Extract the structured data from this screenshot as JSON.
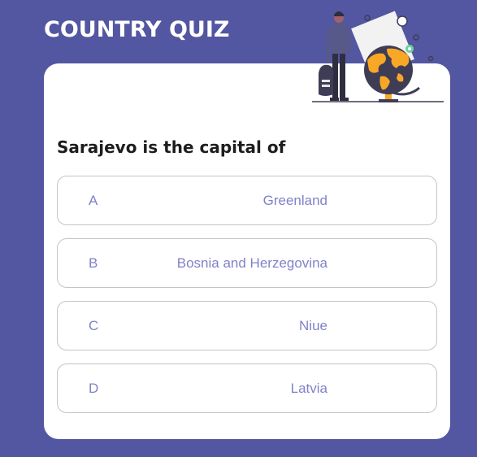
{
  "header": {
    "title": "COUNTRY QUIZ",
    "illustration_icon": "person-with-globe-adventure-icon"
  },
  "quiz": {
    "question": "Sarajevo is the capital of",
    "options": [
      {
        "letter": "A",
        "answer": "Greenland"
      },
      {
        "letter": "B",
        "answer": "Bosnia and Herzegovina"
      },
      {
        "letter": "C",
        "answer": "Niue"
      },
      {
        "letter": "D",
        "answer": "Latvia"
      }
    ]
  },
  "colors": {
    "background": "#5356a0",
    "card": "#ffffff",
    "option_text": "#8082c8",
    "option_border": "#c4c4c4",
    "globe_land": "#f9a826",
    "globe_ocean": "#3f3d56",
    "accent_green": "#6bd29a"
  }
}
